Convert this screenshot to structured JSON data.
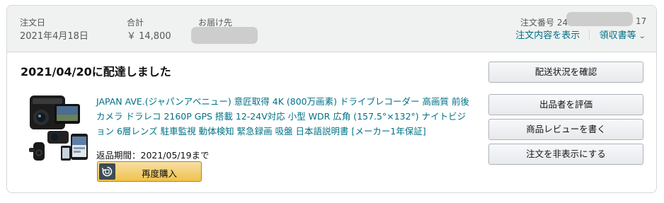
{
  "header": {
    "order_date_label": "注文日",
    "order_date": "2021年4月18日",
    "total_label": "合計",
    "total": "￥ 14,800",
    "ship_to_label": "お届け先",
    "order_number_label": "注文番号 24",
    "order_number_suffix": "17",
    "view_details_link": "注文内容を表示",
    "receipt_link": "領収書等"
  },
  "delivery": {
    "status": "2021/04/20に配達しました"
  },
  "product": {
    "title": "JAPAN AVE.(ジャパンアベニュー) 意匠取得 4K (800万画素) ドライブレコーダー 高画質 前後カメラ ドラレコ 2160P GPS 搭載 12-24V対応 小型 WDR 広角 (157.5°×132°) ナイトビジョン 6層レンズ 駐車監視 動体検知 緊急録画 吸盤 日本語説明書 [メーカー1年保証]",
    "return_window": "返品期間：2021/05/19まで",
    "buy_again_label": "再度購入"
  },
  "actions": {
    "track_package": "配送状況を確認",
    "seller_feedback": "出品者を評価",
    "write_review": "商品レビューを書く",
    "hide_order": "注文を非表示にする"
  },
  "colors": {
    "link": "#007185",
    "header_bg": "#f0f2f2",
    "buy_button": "#f0c14b"
  }
}
